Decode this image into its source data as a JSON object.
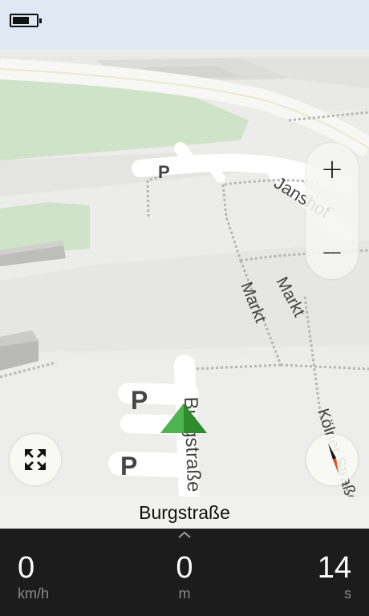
{
  "status": {
    "battery_level": 0.72
  },
  "map": {
    "labels": {
      "street_jans": "Janshof",
      "street_markt_1": "Markt",
      "street_markt_2": "Markt",
      "street_burg": "Burgstraße",
      "street_koel": "Kölner Straße",
      "parking_1": "P",
      "parking_2": "P",
      "parking_3": "P"
    },
    "colors": {
      "park": "#cfe3c8",
      "road": "#ffffff",
      "path": "#b8b8b8",
      "position": "#2e8b2e"
    }
  },
  "controls": {
    "zoom_in_label": "+",
    "zoom_out_label": "−",
    "zoom_in_icon": "plus-icon",
    "zoom_out_icon": "minus-icon",
    "expand_icon": "expand-arrows-icon",
    "compass_icon": "compass-icon"
  },
  "navigation": {
    "current_street": "Burgstraße",
    "speed": {
      "value": "0",
      "unit": "km/h"
    },
    "distance": {
      "value": "0",
      "unit": "m"
    },
    "time": {
      "value": "14",
      "unit": "s"
    }
  }
}
